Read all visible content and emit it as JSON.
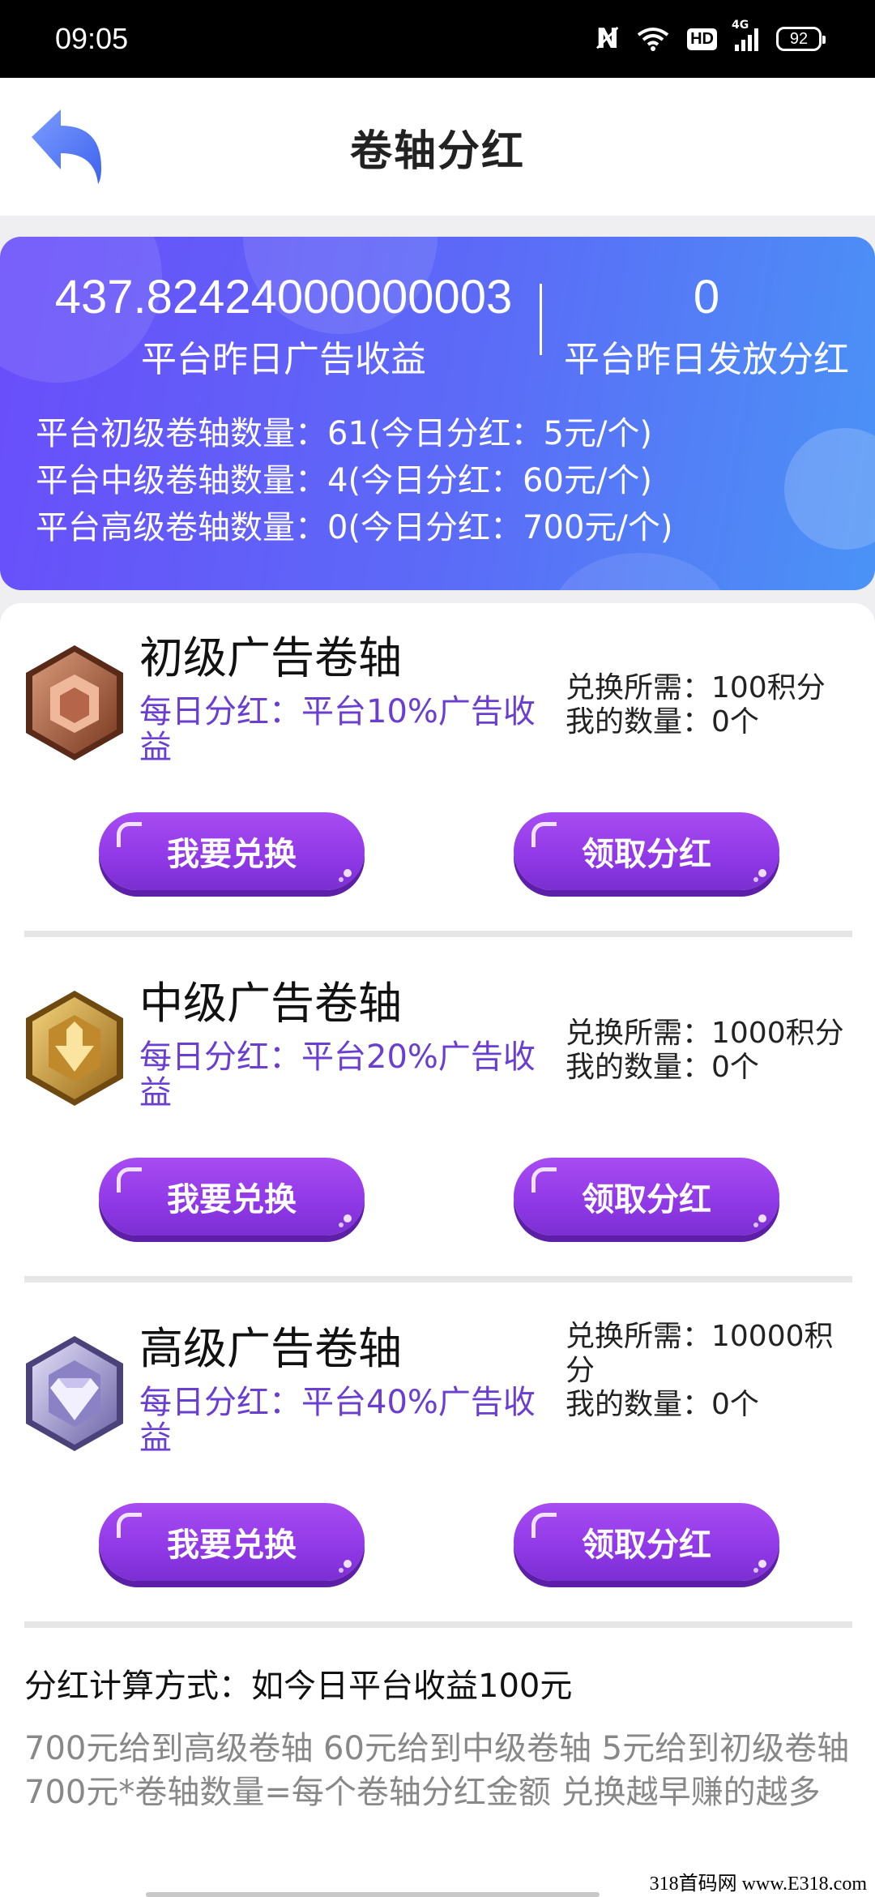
{
  "status_bar": {
    "time": "09:05",
    "hd": "HD",
    "network": "4G",
    "battery": "92"
  },
  "header": {
    "title": "卷轴分红",
    "back_icon": "back-arrow-icon"
  },
  "summary": {
    "yesterday_ad_revenue": "437.82424000000003",
    "yesterday_ad_revenue_label": "平台昨日广告收益",
    "yesterday_dividend": "0",
    "yesterday_dividend_label": "平台昨日发放分红",
    "counts": [
      "平台初级卷轴数量：61(今日分红：5元/个)",
      "平台中级卷轴数量：4(今日分红：60元/个)",
      "平台高级卷轴数量：0(今日分红：700元/个)"
    ]
  },
  "tiers": [
    {
      "name": "初级广告卷轴",
      "desc": "每日分红：平台10%广告收益",
      "cost": "兑换所需：100积分",
      "owned": "我的数量：0个",
      "exchange_label": "我要兑换",
      "claim_label": "领取分红",
      "emblem": "bronze-emblem-icon"
    },
    {
      "name": "中级广告卷轴",
      "desc": "每日分红：平台20%广告收益",
      "cost": "兑换所需：1000积分",
      "owned": "我的数量：0个",
      "exchange_label": "我要兑换",
      "claim_label": "领取分红",
      "emblem": "gold-emblem-icon"
    },
    {
      "name": "高级广告卷轴",
      "desc": "每日分红：平台40%广告收益",
      "cost": "兑换所需：10000积分",
      "owned": "我的数量：0个",
      "exchange_label": "我要兑换",
      "claim_label": "领取分红",
      "emblem": "diamond-emblem-icon"
    }
  ],
  "formula": {
    "title": "分红计算方式：如今日平台收益100元",
    "body": "700元给到高级卷轴 60元给到中级卷轴 5元给到初级卷轴 700元*卷轴数量=每个卷轴分红金额 兑换越早赚的越多"
  },
  "watermark": "318首码网 www.E318.com",
  "colors": {
    "card_gradient_start": "#6a4dfa",
    "card_gradient_end": "#4a93f6",
    "button_purple": "#8f38e6",
    "desc_purple": "#6a3fd0"
  }
}
